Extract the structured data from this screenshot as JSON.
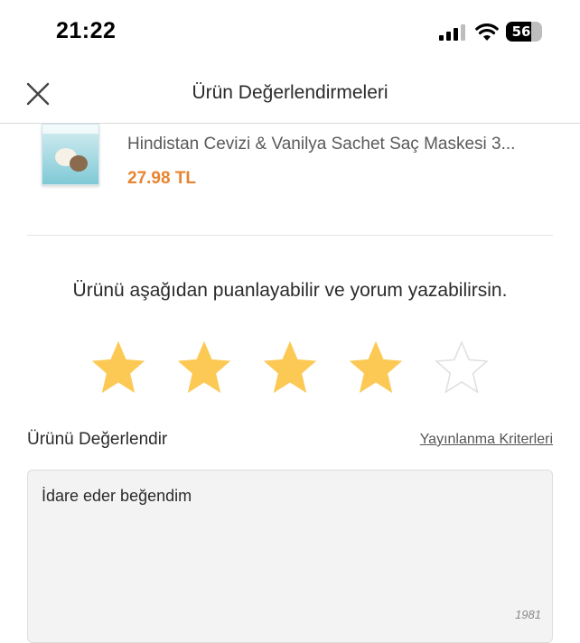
{
  "status_bar": {
    "time": "21:22",
    "battery": "56"
  },
  "header": {
    "title": "Ürün Değerlendirmeleri",
    "close_icon": "close-icon"
  },
  "product": {
    "name": "Hindistan Cevizi & Vanilya Sachet Saç Maskesi 3...",
    "price": "27.98 TL"
  },
  "rating": {
    "prompt": "Ürünü aşağıdan puanlayabilir ve yorum yazabilirsin.",
    "value": 4,
    "max": 5,
    "filled_color": "#fcc955",
    "empty_color": "#e0e0e0"
  },
  "review": {
    "label": "Ürünü Değerlendir",
    "criteria_link": "Yayınlanma Kriterleri",
    "text": "İdare eder beğendim",
    "char_count": "1981"
  },
  "colors": {
    "price": "#e8842f",
    "star": "#fcc955"
  }
}
